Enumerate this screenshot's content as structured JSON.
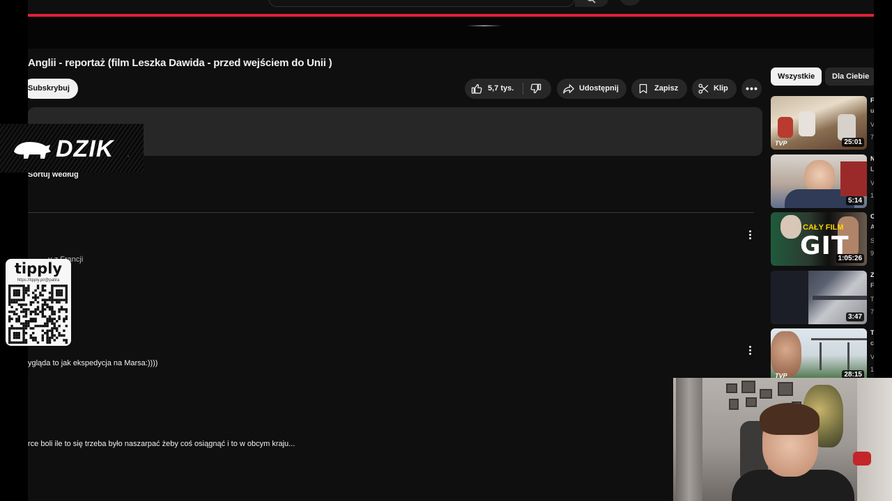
{
  "video": {
    "title": "Anglii - reportaż (film Leszka Dawida - przed wejściem do Unii )",
    "subscribe_label": "Subskrybuj"
  },
  "actions": {
    "likes": "5,7 tys.",
    "share": "Udostępnij",
    "save": "Zapisz",
    "clip": "Klip"
  },
  "comments": {
    "sort_label": "Sortuj według",
    "items": [
      {
        "author_partial": "...y z Francji",
        "text": ""
      },
      {
        "author_partial": "",
        "text": "ygląda to jak ekspedycja na Marsa:))))"
      },
      {
        "author_partial": "",
        "text": "rce boli ile to się trzeba było naszarpać żeby coś osiągnąć i to w obcym kraju..."
      }
    ]
  },
  "sidebar": {
    "chips": [
      "Wszystkie",
      "Dla Ciebie"
    ],
    "recommendations": [
      {
        "duration": "25:01",
        "channel_badge": "TVP",
        "side_chars": [
          "F",
          "u",
          "V",
          "7"
        ]
      },
      {
        "duration": "5:14",
        "channel_badge": "",
        "side_chars": [
          "N",
          "L",
          "V",
          "1"
        ]
      },
      {
        "duration": "1:05:26",
        "channel_badge": "",
        "overlay_text": "CAŁY FILM",
        "big_text": "GIT",
        "side_chars": [
          "C",
          "A",
          "S",
          "9"
        ]
      },
      {
        "duration": "3:47",
        "channel_badge": "",
        "side_chars": [
          "Z",
          "F",
          "T",
          "7"
        ]
      },
      {
        "duration": "28:15",
        "channel_badge": "TVP",
        "side_chars": [
          "T",
          "c",
          "V",
          "1"
        ]
      }
    ]
  },
  "overlays": {
    "dzik_logo": "DZIK",
    "dzik_reg": ".",
    "tipply_logo": "tipply",
    "tipply_url": "https://tipply.pl/@patira"
  },
  "colors": {
    "accent_red": "#e0203a",
    "background": "#0f0f0f",
    "pill": "#272727"
  },
  "icons": [
    "search-icon",
    "microphone-icon",
    "thumbs-up-icon",
    "thumbs-down-icon",
    "share-icon",
    "bookmark-icon",
    "scissors-icon",
    "more-horizontal-icon",
    "more-vertical-icon",
    "boar-icon",
    "qr-code-icon"
  ]
}
